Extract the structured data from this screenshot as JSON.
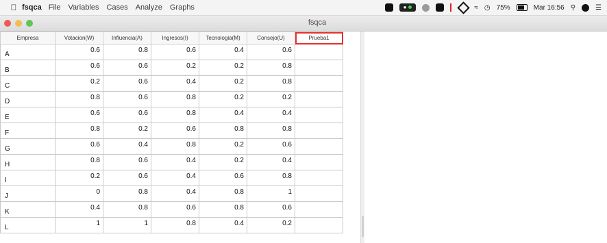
{
  "menubar": {
    "app_name": "fsqca",
    "menus": [
      "File",
      "Variables",
      "Cases",
      "Analyze",
      "Graphs"
    ],
    "status": {
      "battery": "75%",
      "clock": "Mar 16:56"
    }
  },
  "window": {
    "title": "fsqca"
  },
  "grid": {
    "columns": [
      "Empresa",
      "Votacion(W)",
      "Influencia(A)",
      "Ingresos(I)",
      "Tecnologia(M)",
      "Consejo(U)",
      "Prueba1"
    ],
    "rows": [
      {
        "name": "A",
        "values": [
          "0.6",
          "0.8",
          "0.6",
          "0.4",
          "0.6",
          ""
        ]
      },
      {
        "name": "B",
        "values": [
          "0.6",
          "0.6",
          "0.2",
          "0.2",
          "0.8",
          ""
        ]
      },
      {
        "name": "C",
        "values": [
          "0.2",
          "0.6",
          "0.4",
          "0.2",
          "0.8",
          ""
        ]
      },
      {
        "name": "D",
        "values": [
          "0.8",
          "0.6",
          "0.8",
          "0.2",
          "0.2",
          ""
        ]
      },
      {
        "name": "E",
        "values": [
          "0.6",
          "0.6",
          "0.8",
          "0.4",
          "0.4",
          ""
        ]
      },
      {
        "name": "F",
        "values": [
          "0.8",
          "0.2",
          "0.6",
          "0.8",
          "0.8",
          ""
        ]
      },
      {
        "name": "G",
        "values": [
          "0.6",
          "0.4",
          "0.8",
          "0.2",
          "0.6",
          ""
        ]
      },
      {
        "name": "H",
        "values": [
          "0.8",
          "0.6",
          "0.4",
          "0.2",
          "0.4",
          ""
        ]
      },
      {
        "name": "I",
        "values": [
          "0.2",
          "0.6",
          "0.4",
          "0.6",
          "0.8",
          ""
        ]
      },
      {
        "name": "J",
        "values": [
          "0",
          "0.8",
          "0.4",
          "0.8",
          "1",
          ""
        ]
      },
      {
        "name": "K",
        "values": [
          "0.4",
          "0.8",
          "0.6",
          "0.8",
          "0.6",
          ""
        ]
      },
      {
        "name": "L",
        "values": [
          "1",
          "1",
          "0.8",
          "0.4",
          "0.2",
          ""
        ]
      }
    ]
  },
  "colors": {
    "highlight": "#e53030"
  }
}
